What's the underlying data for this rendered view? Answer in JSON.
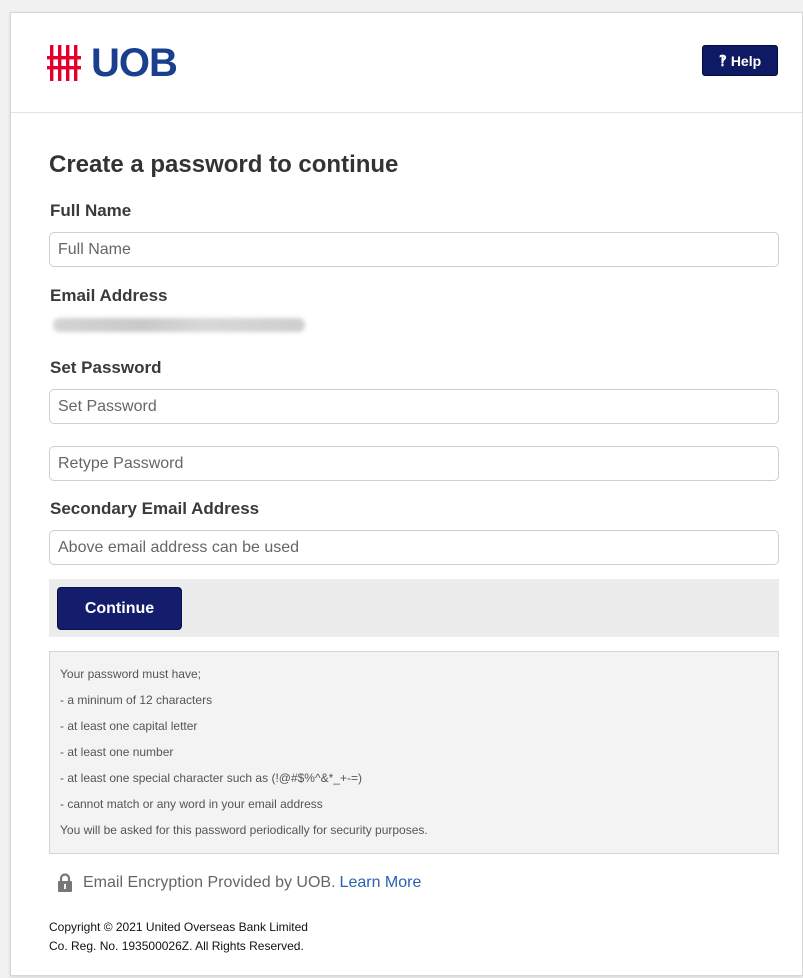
{
  "header": {
    "logo_text": "UOB",
    "help_icon": "help-question-icon",
    "help_label": "Help",
    "brand_colors": {
      "red": "#e4002b",
      "blue": "#1a3f8f",
      "navy": "#0e1a63"
    }
  },
  "form": {
    "title": "Create a password to continue",
    "full_name": {
      "label": "Full Name",
      "placeholder": "Full Name",
      "value": ""
    },
    "email": {
      "label": "Email Address"
    },
    "set_password": {
      "label": "Set Password",
      "placeholder": "Set Password",
      "value": ""
    },
    "retype_password": {
      "placeholder": "Retype Password",
      "value": ""
    },
    "secondary_email": {
      "label": "Secondary Email Address",
      "placeholder": "Above email address can be used",
      "value": ""
    },
    "continue_label": "Continue"
  },
  "rules": {
    "lines": [
      "Your password must have;",
      "- a mininum of 12 characters",
      "- at least one capital letter",
      "- at least one number",
      "- at least one special character such as (!@#$%^&*_+-=)",
      "- cannot match or any word in your email address",
      "You will be asked for this password periodically for security purposes."
    ]
  },
  "encryption": {
    "icon": "lock-icon",
    "text": "Email Encryption Provided by UOB.",
    "link": "Learn More"
  },
  "footer": {
    "line1": "Copyright © 2021 United Overseas Bank Limited",
    "line2": "Co. Reg. No. 193500026Z. All Rights Reserved."
  }
}
